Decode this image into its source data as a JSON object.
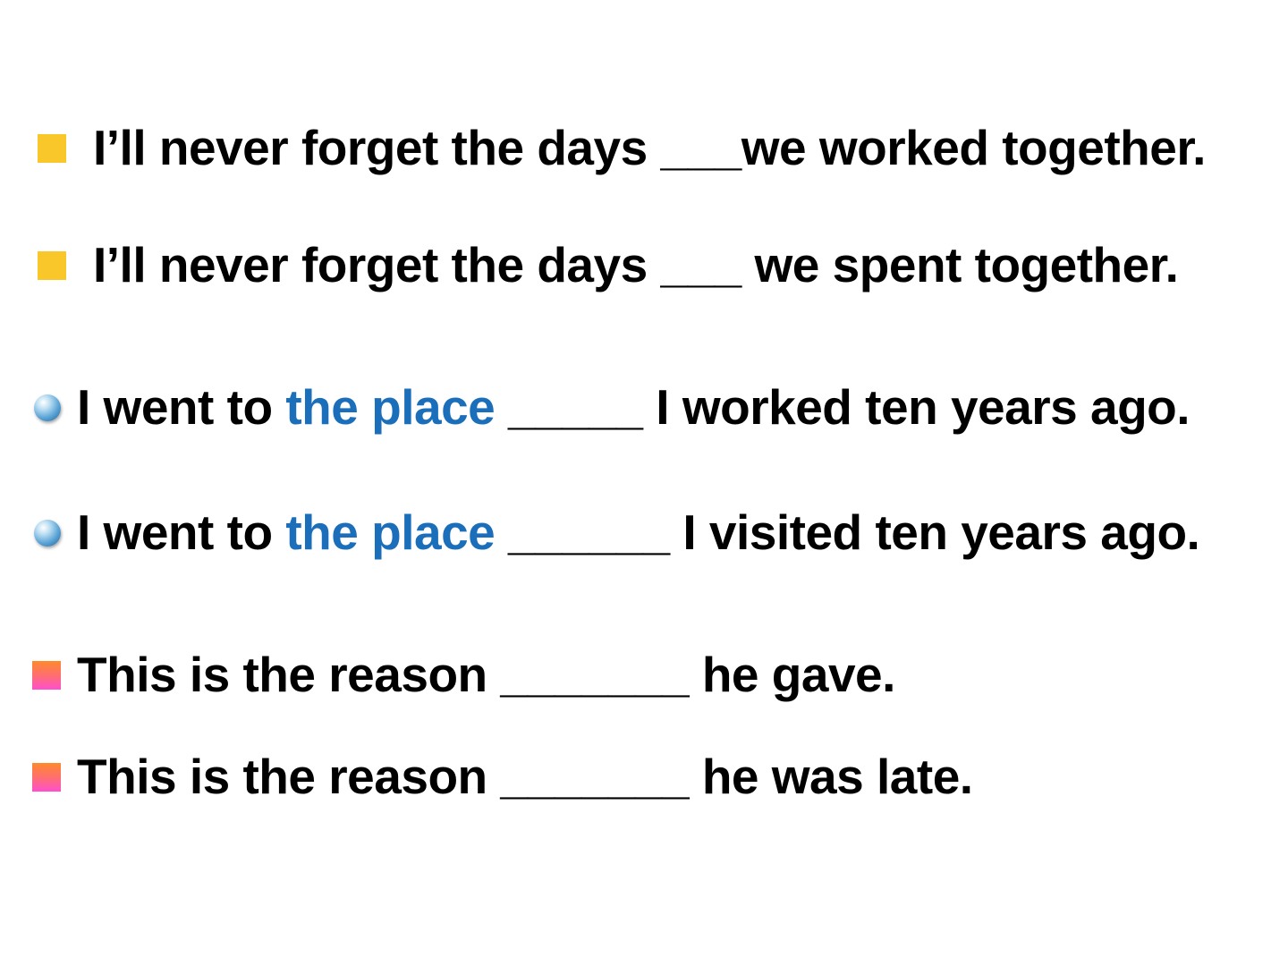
{
  "colors": {
    "text": "#000000",
    "highlight": "#1b6fba",
    "square_bullet": "#f9c72a",
    "ball_bullet": "#5aa4d6",
    "gradient_bullet_top": "#ff8a2a",
    "gradient_bullet_bottom": "#ff4fcf"
  },
  "lines": [
    {
      "bullet": "yellow-square",
      "text": "I’ll never forget the days ___we worked together."
    },
    {
      "bullet": "yellow-square",
      "text": "I’ll never forget the days ___ we spent together."
    },
    {
      "bullet": "blue-ball",
      "before": "I went to ",
      "highlight": "the place",
      "after": " _____ I worked ten years ago."
    },
    {
      "bullet": "blue-ball",
      "before": "I went to ",
      "highlight": "the place",
      "after": " ______ I visited ten years ago."
    },
    {
      "bullet": "gradient-square",
      "text": "This is the reason _______ he gave."
    },
    {
      "bullet": "gradient-square",
      "text": "This is the reason _______ he was late."
    }
  ]
}
